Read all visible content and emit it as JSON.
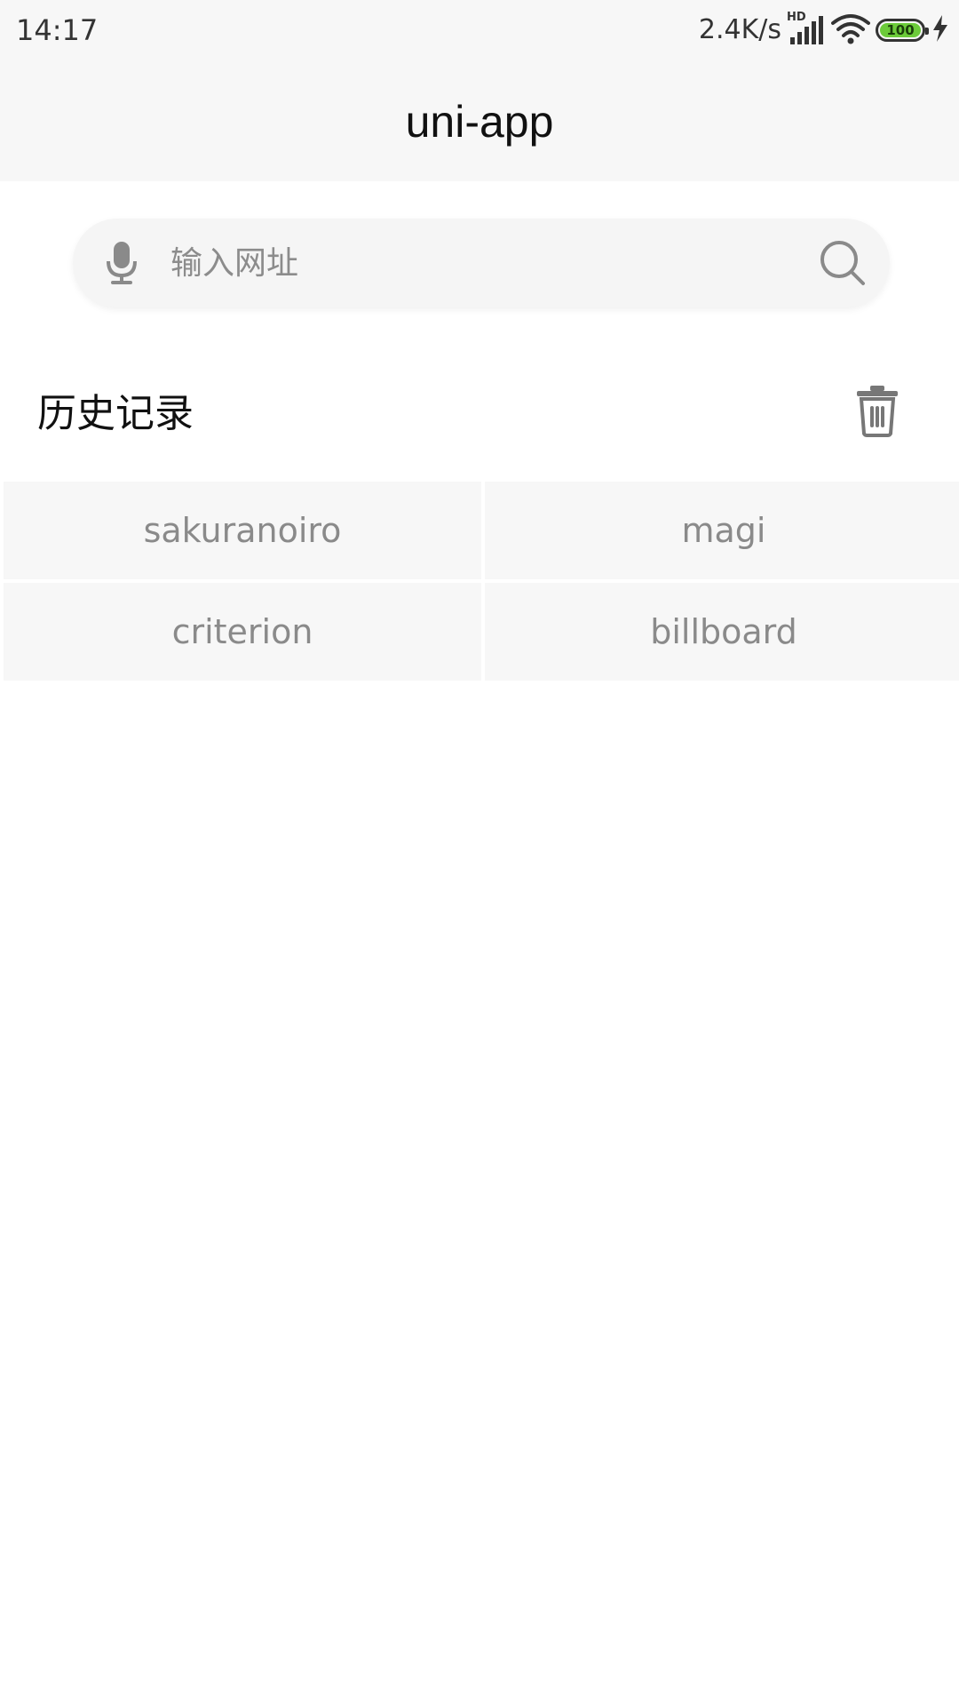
{
  "status_bar": {
    "time": "14:17",
    "net_speed": "2.4K/s",
    "network_badge": "HD",
    "battery_level": "100",
    "icons": [
      "signal-icon",
      "wifi-icon",
      "battery-icon",
      "charging-icon"
    ]
  },
  "navbar": {
    "title": "uni-app"
  },
  "search": {
    "placeholder": "输入网址",
    "value": "",
    "icons": [
      "microphone-icon",
      "search-icon"
    ]
  },
  "history": {
    "title": "历史记录",
    "clear_icon": "trash-icon",
    "items": [
      "sakuranoiro",
      "magi",
      "criterion",
      "billboard"
    ]
  },
  "colors": {
    "bar_background": "#f7f7f7",
    "item_background": "#f7f7f7",
    "item_text": "#8a8a8a",
    "battery_fill": "#6ccb3a"
  }
}
